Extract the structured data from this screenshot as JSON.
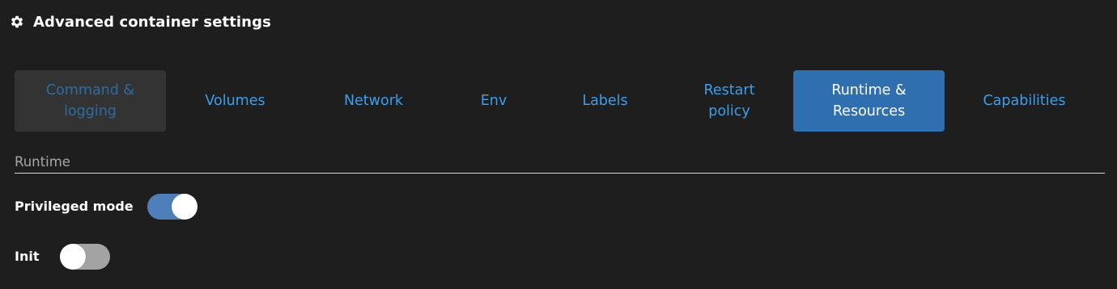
{
  "header": {
    "icon": "gear-icon",
    "title": "Advanced container settings"
  },
  "tabs": [
    {
      "label": "Command &\nlogging",
      "state": "disabled"
    },
    {
      "label": "Volumes",
      "state": "normal"
    },
    {
      "label": "Network",
      "state": "normal"
    },
    {
      "label": "Env",
      "state": "normal"
    },
    {
      "label": "Labels",
      "state": "normal"
    },
    {
      "label": "Restart\npolicy",
      "state": "normal"
    },
    {
      "label": "Runtime &\nResources",
      "state": "active"
    },
    {
      "label": "Capabilities",
      "state": "normal"
    }
  ],
  "runtime": {
    "section_title": "Runtime",
    "privileged_mode": {
      "label": "Privileged mode",
      "enabled": true
    },
    "init": {
      "label": "Init",
      "enabled": false
    }
  },
  "colors": {
    "background": "#1e1e1e",
    "tab_link": "#3d9ee9",
    "tab_active_bg": "#2f6fb0",
    "tab_disabled_bg": "#333333",
    "toggle_on": "#4f7fb8",
    "toggle_off": "#a3a3a3"
  }
}
